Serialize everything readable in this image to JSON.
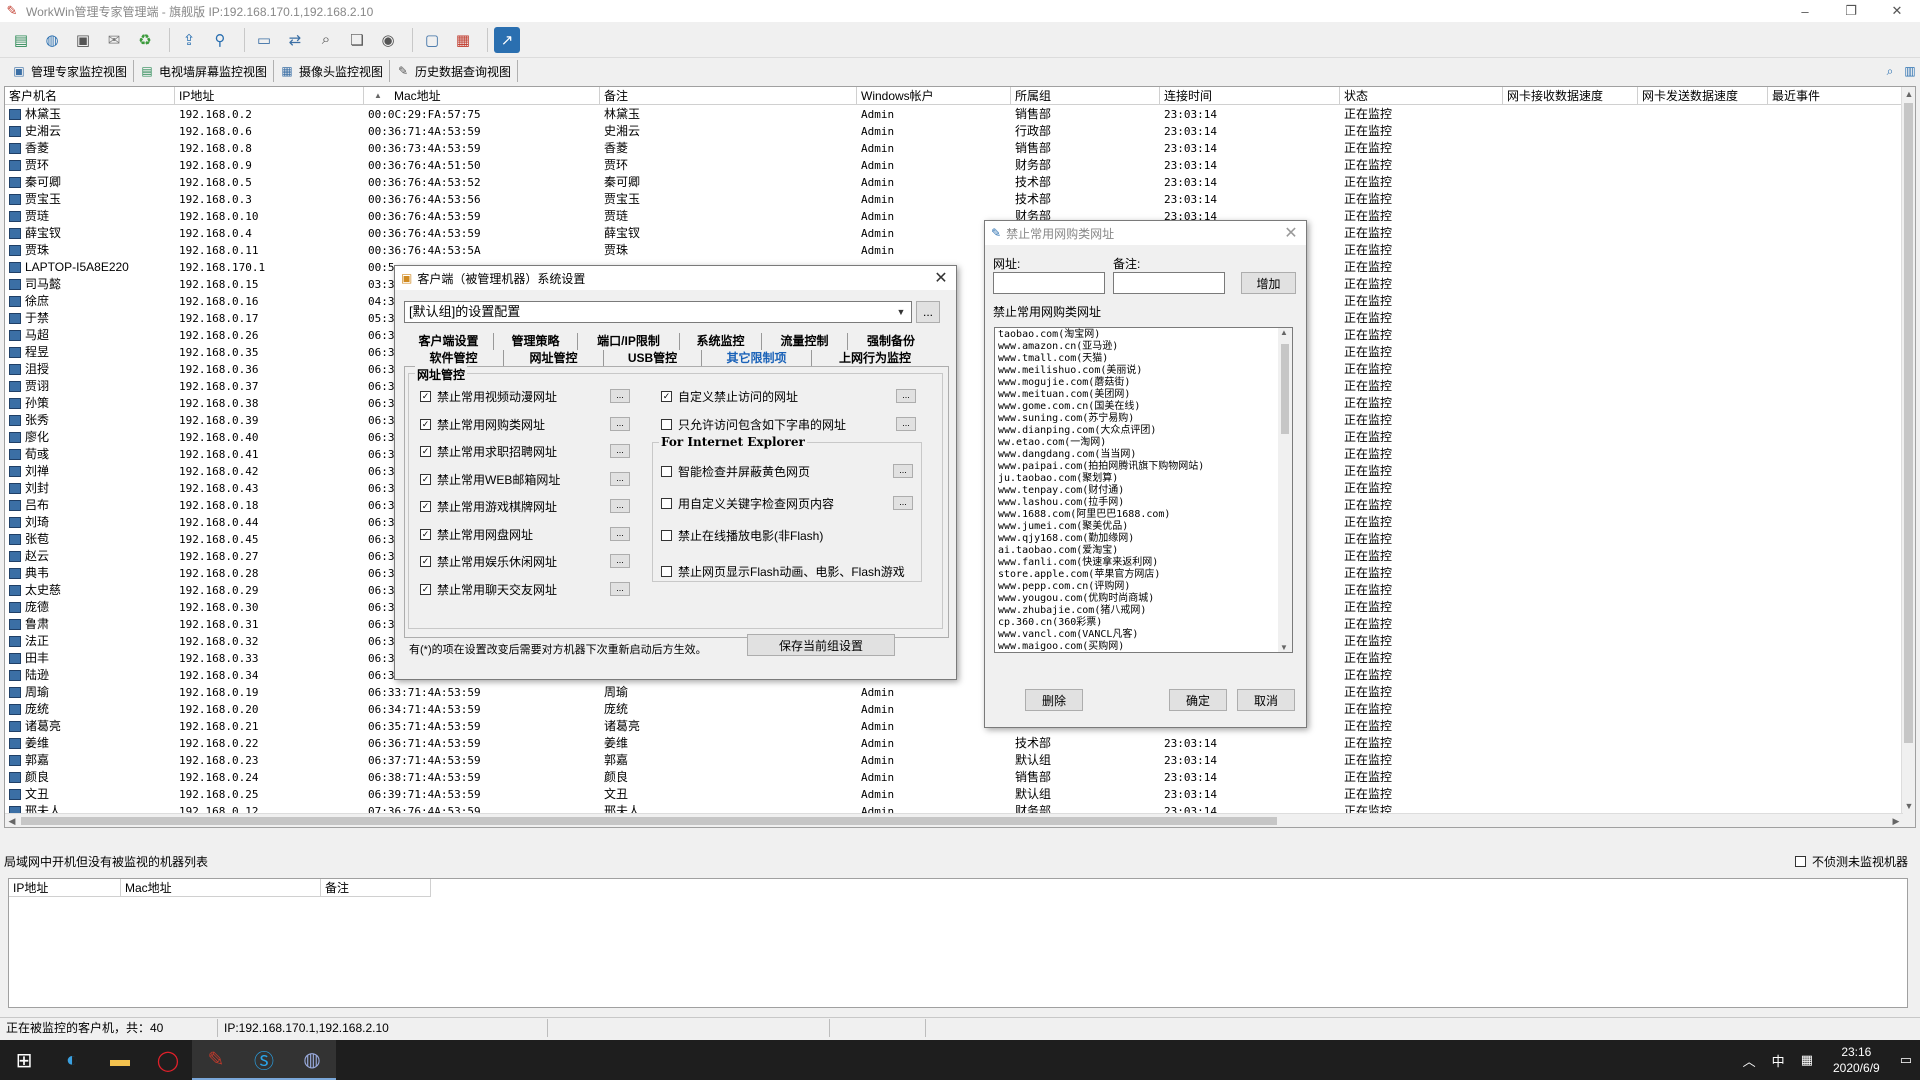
{
  "window": {
    "title": "WorkWin管理专家管理端 - 旗舰版 IP:192.168.170.1,192.168.2.10",
    "controls": [
      "–",
      "❐",
      "✕"
    ]
  },
  "toolbar": {
    "icons": [
      "db-icon",
      "globe-icon",
      "computer-icon",
      "mail-icon",
      "recycle-icon",
      "share-icon",
      "pin-icon",
      "monitor-icon",
      "remote-icon",
      "search-doc-icon",
      "window-icon",
      "camera-icon",
      "screen-icon",
      "table-icon",
      "chart-icon"
    ]
  },
  "viewtabs": [
    {
      "label": "管理专家监控视图",
      "icon": "monitor-view-icon"
    },
    {
      "label": "电视墙屏幕监控视图",
      "icon": "tv-wall-icon"
    },
    {
      "label": "摄像头监控视图",
      "icon": "camera-view-icon"
    },
    {
      "label": "历史数据查询视图",
      "icon": "history-icon"
    }
  ],
  "grid": {
    "columns": [
      "客户机名",
      "IP地址",
      "Mac地址",
      "备注",
      "Windows帐户",
      "所属组",
      "连接时间",
      "状态",
      "网卡接收数据速度",
      "网卡发送数据速度",
      "最近事件"
    ],
    "rows": [
      [
        "林黛玉",
        "192.168.0.2",
        "00:0C:29:FA:57:75",
        "林黛玉",
        "Admin",
        "销售部",
        "23:03:14",
        "正在监控"
      ],
      [
        "史湘云",
        "192.168.0.6",
        "00:36:71:4A:53:59",
        "史湘云",
        "Admin",
        "行政部",
        "23:03:14",
        "正在监控"
      ],
      [
        "香菱",
        "192.168.0.8",
        "00:36:73:4A:53:59",
        "香菱",
        "Admin",
        "销售部",
        "23:03:14",
        "正在监控"
      ],
      [
        "贾环",
        "192.168.0.9",
        "00:36:76:4A:51:50",
        "贾环",
        "Admin",
        "财务部",
        "23:03:14",
        "正在监控"
      ],
      [
        "秦可卿",
        "192.168.0.5",
        "00:36:76:4A:53:52",
        "秦可卿",
        "Admin",
        "技术部",
        "23:03:14",
        "正在监控"
      ],
      [
        "贾宝玉",
        "192.168.0.3",
        "00:36:76:4A:53:56",
        "贾宝玉",
        "Admin",
        "技术部",
        "23:03:14",
        "正在监控"
      ],
      [
        "贾琏",
        "192.168.0.10",
        "00:36:76:4A:53:59",
        "贾琏",
        "Admin",
        "财务部",
        "23:03:14",
        "正在监控"
      ],
      [
        "薛宝钗",
        "192.168.0.4",
        "00:36:76:4A:53:59",
        "薛宝钗",
        "Admin",
        "",
        "",
        "正在监控"
      ],
      [
        "贾珠",
        "192.168.0.11",
        "00:36:76:4A:53:5A",
        "贾珠",
        "Admin",
        "",
        "",
        "正在监控"
      ],
      [
        "LAPTOP-I5A8E220",
        "192.168.170.1",
        "00:5",
        "",
        "",
        "",
        "",
        "正在监控"
      ],
      [
        "司马懿",
        "192.168.0.15",
        "03:3",
        "",
        "",
        "",
        "",
        "正在监控"
      ],
      [
        "徐庶",
        "192.168.0.16",
        "04:3",
        "",
        "",
        "",
        "",
        "正在监控"
      ],
      [
        "于禁",
        "192.168.0.17",
        "05:3",
        "",
        "",
        "",
        "",
        "正在监控"
      ],
      [
        "马超",
        "192.168.0.26",
        "06:3",
        "",
        "",
        "",
        "",
        "正在监控"
      ],
      [
        "程昱",
        "192.168.0.35",
        "06:3",
        "",
        "",
        "",
        "",
        "正在监控"
      ],
      [
        "沮授",
        "192.168.0.36",
        "06:3",
        "",
        "",
        "",
        "",
        "正在监控"
      ],
      [
        "贾诩",
        "192.168.0.37",
        "06:3",
        "",
        "",
        "",
        "",
        "正在监控"
      ],
      [
        "孙策",
        "192.168.0.38",
        "06:3",
        "",
        "",
        "",
        "",
        "正在监控"
      ],
      [
        "张秀",
        "192.168.0.39",
        "06:3",
        "",
        "",
        "",
        "",
        "正在监控"
      ],
      [
        "廖化",
        "192.168.0.40",
        "06:3",
        "",
        "",
        "",
        "",
        "正在监控"
      ],
      [
        "荀彧",
        "192.168.0.41",
        "06:3",
        "",
        "",
        "",
        "",
        "正在监控"
      ],
      [
        "刘禅",
        "192.168.0.42",
        "06:3",
        "",
        "",
        "",
        "",
        "正在监控"
      ],
      [
        "刘封",
        "192.168.0.43",
        "06:3",
        "",
        "",
        "",
        "",
        "正在监控"
      ],
      [
        "吕布",
        "192.168.0.18",
        "06:3",
        "",
        "",
        "",
        "",
        "正在监控"
      ],
      [
        "刘琦",
        "192.168.0.44",
        "06:3",
        "",
        "",
        "",
        "",
        "正在监控"
      ],
      [
        "张苞",
        "192.168.0.45",
        "06:3",
        "",
        "",
        "",
        "",
        "正在监控"
      ],
      [
        "赵云",
        "192.168.0.27",
        "06:3",
        "",
        "",
        "",
        "",
        "正在监控"
      ],
      [
        "典韦",
        "192.168.0.28",
        "06:3",
        "",
        "",
        "",
        "",
        "正在监控"
      ],
      [
        "太史慈",
        "192.168.0.29",
        "06:3",
        "",
        "",
        "",
        "",
        "正在监控"
      ],
      [
        "庞德",
        "192.168.0.30",
        "06:3",
        "",
        "",
        "",
        "",
        "正在监控"
      ],
      [
        "鲁肃",
        "192.168.0.31",
        "06:3",
        "",
        "",
        "",
        "",
        "正在监控"
      ],
      [
        "法正",
        "192.168.0.32",
        "06:3",
        "",
        "",
        "",
        "",
        "正在监控"
      ],
      [
        "田丰",
        "192.168.0.33",
        "06:3",
        "",
        "",
        "",
        "",
        "正在监控"
      ],
      [
        "陆逊",
        "192.168.0.34",
        "06:3",
        "",
        "",
        "",
        "",
        "正在监控"
      ],
      [
        "周瑜",
        "192.168.0.19",
        "06:33:71:4A:53:59",
        "周瑜",
        "Admin",
        "",
        "",
        "正在监控"
      ],
      [
        "庞统",
        "192.168.0.20",
        "06:34:71:4A:53:59",
        "庞统",
        "Admin",
        "",
        "",
        "正在监控"
      ],
      [
        "诸葛亮",
        "192.168.0.21",
        "06:35:71:4A:53:59",
        "诸葛亮",
        "Admin",
        "",
        "",
        "正在监控"
      ],
      [
        "姜维",
        "192.168.0.22",
        "06:36:71:4A:53:59",
        "姜维",
        "Admin",
        "技术部",
        "23:03:14",
        "正在监控"
      ],
      [
        "郭嘉",
        "192.168.0.23",
        "06:37:71:4A:53:59",
        "郭嘉",
        "Admin",
        "默认组",
        "23:03:14",
        "正在监控"
      ],
      [
        "颜良",
        "192.168.0.24",
        "06:38:71:4A:53:59",
        "颜良",
        "Admin",
        "销售部",
        "23:03:14",
        "正在监控"
      ],
      [
        "文丑",
        "192.168.0.25",
        "06:39:71:4A:53:59",
        "文丑",
        "Admin",
        "默认组",
        "23:03:14",
        "正在监控"
      ],
      [
        "邢夫人",
        "192.168.0.12",
        "07:36:76:4A:53:59",
        "邢夫人",
        "Admin",
        "财务部",
        "23:03:14",
        "正在监控"
      ]
    ]
  },
  "bottom": {
    "title": "局域网中开机但没有被监视的机器列表",
    "checkbox_label": "不侦测未监视机器",
    "columns": [
      "IP地址",
      "Mac地址",
      "备注"
    ]
  },
  "statusbar": {
    "count": "正在被监控的客户机，共：40",
    "ip": "IP:192.168.170.1,192.168.2.10"
  },
  "settings_dialog": {
    "title": "客户端（被管理机器）系统设置",
    "combo_value": "[默认组]的设置配置",
    "combo_btn": "...",
    "tabs_row1": [
      "客户端设置",
      "管理策略",
      "端口/IP限制",
      "系统监控",
      "流量控制",
      "强制备份"
    ],
    "tabs_row2": [
      "软件管控",
      "网址管控",
      "USB管控",
      "其它限制项",
      "上网行为监控"
    ],
    "group_title": "网址管控",
    "left_options": [
      {
        "label": "禁止常用视频动漫网址",
        "checked": true
      },
      {
        "label": "禁止常用网购类网址",
        "checked": true
      },
      {
        "label": "禁止常用求职招聘网址",
        "checked": true
      },
      {
        "label": "禁止常用WEB邮箱网址",
        "checked": true
      },
      {
        "label": "禁止常用游戏棋牌网址",
        "checked": true
      },
      {
        "label": "禁止常用网盘网址",
        "checked": true
      },
      {
        "label": "禁止常用娱乐休闲网址",
        "checked": true
      },
      {
        "label": "禁止常用聊天交友网址",
        "checked": true
      }
    ],
    "right_options": [
      {
        "label": "自定义禁止访问的网址",
        "checked": true
      },
      {
        "label": "只允许访问包含如下字串的网址",
        "checked": false
      }
    ],
    "ie_group_title": "For Internet Explorer",
    "ie_options": [
      {
        "label": "智能检查并屏蔽黄色网页",
        "checked": false
      },
      {
        "label": "用自定义关键字检查网页内容",
        "checked": false
      },
      {
        "label": "禁止在线播放电影(非Flash)",
        "checked": false
      },
      {
        "label": "禁止网页显示Flash动画、电影、Flash游戏",
        "checked": false
      }
    ],
    "note": "有(*)的项在设置改变后需要对方机器下次重新启动后方生效。",
    "save_label": "保存当前组设置",
    "ellipsis": "..."
  },
  "shop_dialog": {
    "title": "禁止常用网购类网址",
    "url_label": "网址:",
    "note_label": "备注:",
    "add_label": "增加",
    "list_label": "禁止常用网购类网址",
    "list": [
      "taobao.com(淘宝网)",
      "www.amazon.cn(亚马逊)",
      "www.tmall.com(天猫)",
      "www.meilishuo.com(美丽说)",
      "www.mogujie.com(蘑菇街)",
      "www.meituan.com(美团网)",
      "www.gome.com.cn(国美在线)",
      "www.suning.com(苏宁易购)",
      "www.dianping.com(大众点评团)",
      "ww.etao.com(一淘网)",
      "www.dangdang.com(当当网)",
      "www.paipai.com(拍拍网腾讯旗下购物网站)",
      "ju.taobao.com(聚划算)",
      "www.tenpay.com(财付通)",
      "www.lashou.com(拉手网)",
      "www.1688.com(阿里巴巴1688.com)",
      "www.jumei.com(聚美优品)",
      "www.qjy168.com(勤加缘网)",
      "ai.taobao.com(爱淘宝)",
      "www.fanli.com(快速拿来返利网)",
      "store.apple.com(苹果官方网店)",
      "www.pepp.com.cn(评购网)",
      "www.yougou.com(优购时尚商城)",
      "www.zhubajie.com(猪八戒网)",
      "cp.360.cn(360彩票)",
      "www.vancl.com(VANCL凡客)",
      "www.maigoo.com(买购网)"
    ],
    "delete_label": "删除",
    "ok_label": "确定",
    "cancel_label": "取消"
  },
  "taskbar": {
    "time": "23:16",
    "date": "2020/6/9",
    "ime": "中",
    "apps": [
      "windows-start-icon",
      "edge-icon",
      "explorer-icon",
      "opera-icon",
      "workwin-icon",
      "skype-icon",
      "app-icon"
    ]
  }
}
